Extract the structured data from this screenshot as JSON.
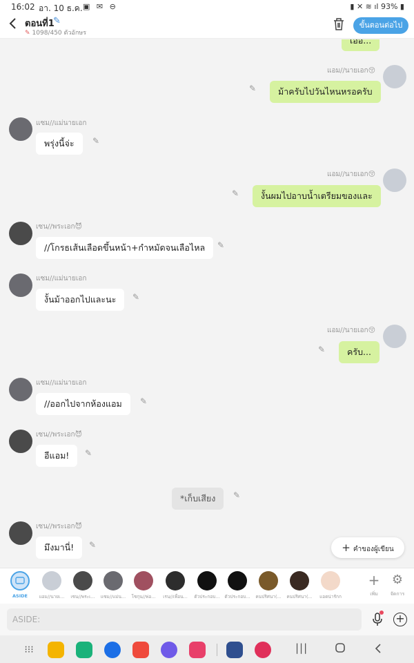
{
  "status_bar": {
    "time": "16:02",
    "date": "อา. 10 ธ.ค.",
    "battery": "93%"
  },
  "header": {
    "title": "ตอนที่1",
    "counter": "1098/450 ตัวอักษร",
    "next_label": "ขั้นตอนต่อไป"
  },
  "chat": {
    "top_partial_text": "เออ...",
    "messages": [
      {
        "side": "right",
        "name": "แอม//นายเอก😚",
        "text": "ม้าครับไปวันไหนหรอครับ"
      },
      {
        "side": "left",
        "name": "แซม//แม่นายเอก",
        "text": "พรุ่งนี้จ่ะ"
      },
      {
        "side": "right",
        "name": "แอม//นายเอก😚",
        "text": "งั้นผมไปอาบน้ำเตรียมของและ"
      },
      {
        "side": "left",
        "name": "เซน//พระเอก😈",
        "text": "//โกรธเส้นเลือดขึ้นหน้า+กำหมัดจนเลือไหล"
      },
      {
        "side": "left",
        "name": "แซม//แม่นายเอก",
        "text": "งั้นม้าออกไปและนะ"
      },
      {
        "side": "right",
        "name": "แอม//นายเอก😚",
        "text": "ครับ..."
      },
      {
        "side": "left",
        "name": "แซม//แม่นายเอก",
        "text": "//ออกไปจากห้องแอม"
      },
      {
        "side": "left",
        "name": "เซน//พระเอก😈",
        "text": "อีแอม!"
      },
      {
        "side": "center",
        "name": "",
        "text": "*เก็บเสียง"
      },
      {
        "side": "left",
        "name": "เซน//พระเอก😈",
        "text": "มึงมานี่!"
      }
    ]
  },
  "fab": {
    "label": "คำของผู้เขียน"
  },
  "characters": [
    {
      "label": "ASIDE",
      "color": "#cfe4f8"
    },
    {
      "label": "แอม//นายเ...",
      "color": "#c9ced6"
    },
    {
      "label": "เซน//พระเ...",
      "color": "#4a4a4a"
    },
    {
      "label": "แซม//แม่น...",
      "color": "#6a6a70"
    },
    {
      "label": "โซกุน//พ่อ...",
      "color": "#a05060"
    },
    {
      "label": "เรน//เพื่อน...",
      "color": "#2d2d2d"
    },
    {
      "label": "ตัวประกอบ...",
      "color": "#111111"
    },
    {
      "label": "ตัวประกอบ...",
      "color": "#111111"
    },
    {
      "label": "คนปริศนา(...",
      "color": "#7a5a2a"
    },
    {
      "label": "คนปริศนา(...",
      "color": "#3a2a22"
    },
    {
      "label": "แอดน่ารักก",
      "color": "#f3d9c9"
    }
  ],
  "toolbar": {
    "add_label": "เพิ่ม",
    "manage_label": "จัดการ"
  },
  "input": {
    "placeholder": "ASIDE:"
  },
  "colors": {
    "accent": "#4aa3e6",
    "right_bubble": "#d6f2a0",
    "left_bubble": "#ffffff"
  },
  "nav_apps": [
    {
      "icon": "app-drawer-icon",
      "color": ""
    },
    {
      "icon": "files-icon",
      "color": "#f4b400"
    },
    {
      "icon": "phone-icon",
      "color": "#1ab27a"
    },
    {
      "icon": "messages-icon",
      "color": "#1c6fe6"
    },
    {
      "icon": "notes-icon",
      "color": "#ef4a3c"
    },
    {
      "icon": "internet-icon",
      "color": "#6f5ae8"
    },
    {
      "icon": "camera-icon",
      "color": "#e8406a"
    },
    {
      "icon": "settings-icon",
      "color": "#2f4f8f"
    },
    {
      "icon": "flower-icon",
      "color": "#e0305a"
    }
  ]
}
